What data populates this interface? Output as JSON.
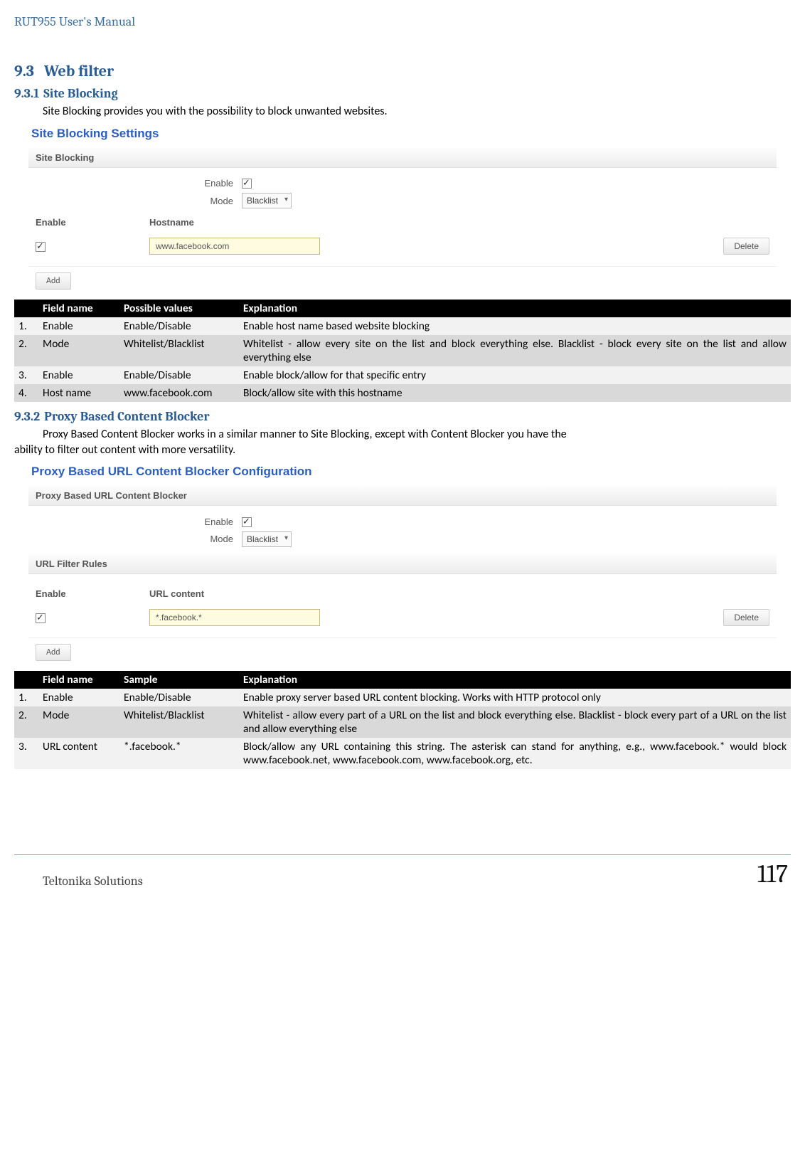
{
  "doc_header": "RUT955 User's Manual",
  "section_h2_num": "9.3",
  "section_h2_title": "Web filter",
  "site_blocking": {
    "h3_num": "9.3.1",
    "h3_title": "Site Blocking",
    "intro": "Site Blocking provides you with the possibility to block unwanted websites.",
    "panel_title": "Site Blocking Settings",
    "tab_label": "Site Blocking",
    "enable_label": "Enable",
    "mode_label": "Mode",
    "mode_value": "Blacklist",
    "col_enable": "Enable",
    "col_hostname": "Hostname",
    "hostname_value": "www.facebook.com",
    "delete_label": "Delete",
    "add_label": "Add",
    "table": {
      "head": [
        "",
        "Field name",
        "Possible values",
        "Explanation"
      ],
      "rows": [
        {
          "n": "1.",
          "field": "Enable",
          "val": "Enable/Disable",
          "exp": "Enable host name based website blocking"
        },
        {
          "n": "2.",
          "field": "Mode",
          "val": "Whitelist/Blacklist",
          "exp": "Whitelist - allow every site on the list and block everything else. Blacklist - block every site on the list and allow everything else"
        },
        {
          "n": "3.",
          "field": "Enable",
          "val": "Enable/Disable",
          "exp": "Enable block/allow for that specific entry"
        },
        {
          "n": "4.",
          "field": "Host name",
          "val": "www.facebook.com",
          "exp": "Block/allow site with this hostname"
        }
      ]
    }
  },
  "proxy": {
    "h3_num": "9.3.2",
    "h3_title": "Proxy Based Content Blocker",
    "intro_1": "Proxy Based Content Blocker works in a similar manner to Site Blocking, except with Content Blocker you have the ",
    "intro_2": "ability to filter out content with more versatility.",
    "panel_title": "Proxy Based URL Content Blocker Configuration",
    "tab_label": "Proxy Based URL Content Blocker",
    "enable_label": "Enable",
    "mode_label": "Mode",
    "mode_value": "Blacklist",
    "rules_label": "URL Filter Rules",
    "col_enable": "Enable",
    "col_url": "URL content",
    "url_value": "*.facebook.*",
    "delete_label": "Delete",
    "add_label": "Add",
    "table": {
      "head": [
        "",
        "Field name",
        "Sample",
        "Explanation"
      ],
      "rows": [
        {
          "n": "1.",
          "field": "Enable",
          "val": "Enable/Disable",
          "exp": "Enable proxy server based URL content blocking. Works with HTTP protocol only"
        },
        {
          "n": "2.",
          "field": "Mode",
          "val": "Whitelist/Blacklist",
          "exp": "Whitelist - allow every part of a URL on the list and block everything else. Blacklist - block every part of a URL on the list and allow everything else"
        },
        {
          "n": "3.",
          "field": "URL content",
          "val": "*.facebook.*",
          "exp": "Block/allow any URL containing this string. The asterisk can stand for anything, e.g., www.facebook.* would block www.facebook.net, www.facebook.com, www.facebook.org, etc."
        }
      ]
    }
  },
  "footer_left": "Teltonika Solutions",
  "footer_right": "117"
}
